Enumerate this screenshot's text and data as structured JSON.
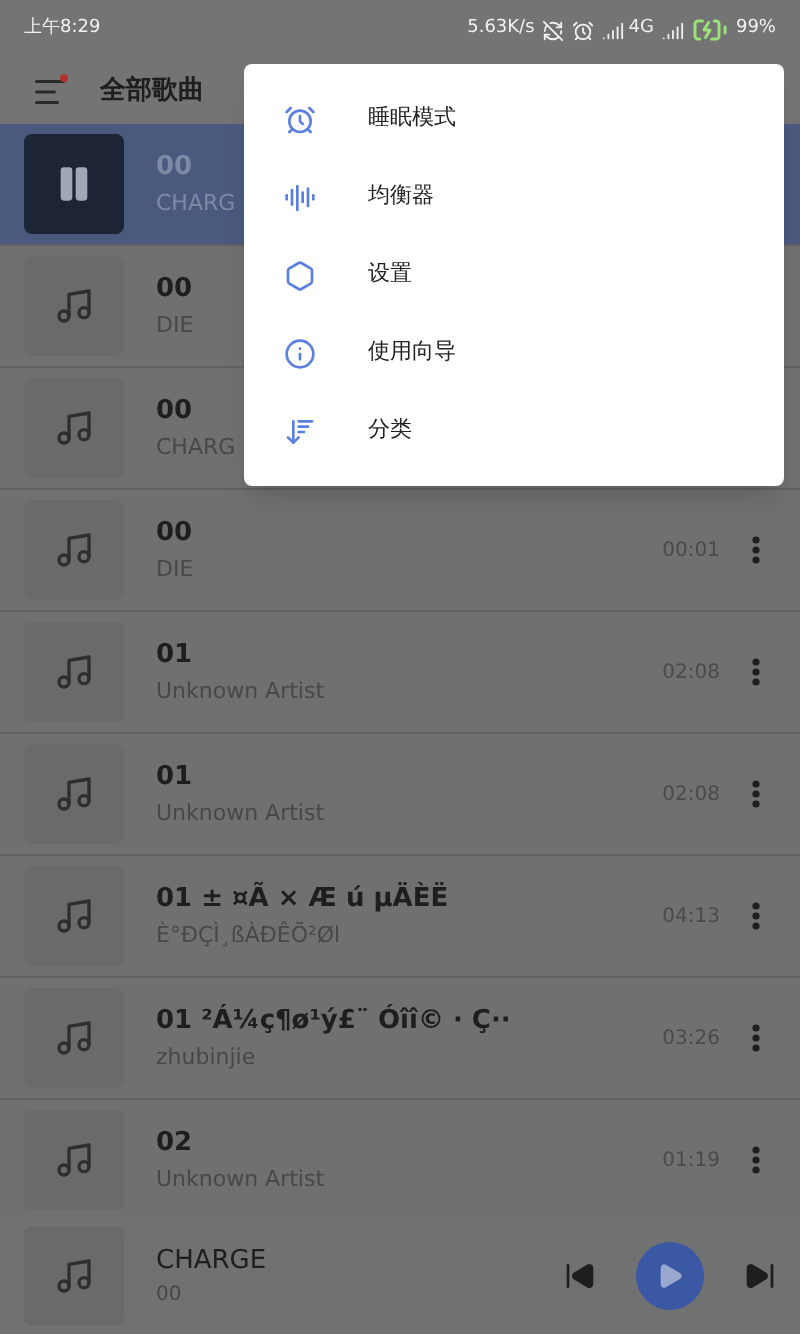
{
  "status_bar": {
    "time": "上午8:29",
    "speed": "5.63K/s",
    "network": "4G",
    "battery": "99%"
  },
  "toolbar": {
    "title": "全部歌曲"
  },
  "songs": [
    {
      "title": "00",
      "artist": "CHARG",
      "playing": true
    },
    {
      "title": "00",
      "artist": "DIE",
      "playing": false
    },
    {
      "title": "00",
      "artist": "CHARG",
      "playing": false
    },
    {
      "title": "00",
      "artist": "DIE",
      "duration": "00:01",
      "playing": false
    },
    {
      "title": "01",
      "artist": "Unknown Artist",
      "duration": "02:08",
      "playing": false
    },
    {
      "title": "01",
      "artist": "Unknown Artist",
      "duration": "02:08",
      "playing": false
    },
    {
      "title": "01  ± ¤Ã × Æ ú µÄÈË",
      "artist": "È°ÐÇÌ¸ßÀÐÊÕ²Øl",
      "duration": "04:13",
      "playing": false
    },
    {
      "title": "01 ²Á¼ç¶ø¹ý£¨ Óîî© · Ç··",
      "artist": "zhubinjie",
      "duration": "03:26",
      "playing": false
    },
    {
      "title": "02",
      "artist": "Unknown Artist",
      "duration": "01:19",
      "playing": false
    }
  ],
  "menu": [
    {
      "label": "睡眠模式"
    },
    {
      "label": "均衡器"
    },
    {
      "label": "设置"
    },
    {
      "label": "使用向导"
    },
    {
      "label": "分类"
    }
  ],
  "player": {
    "title": "CHARGE",
    "artist": "00"
  }
}
